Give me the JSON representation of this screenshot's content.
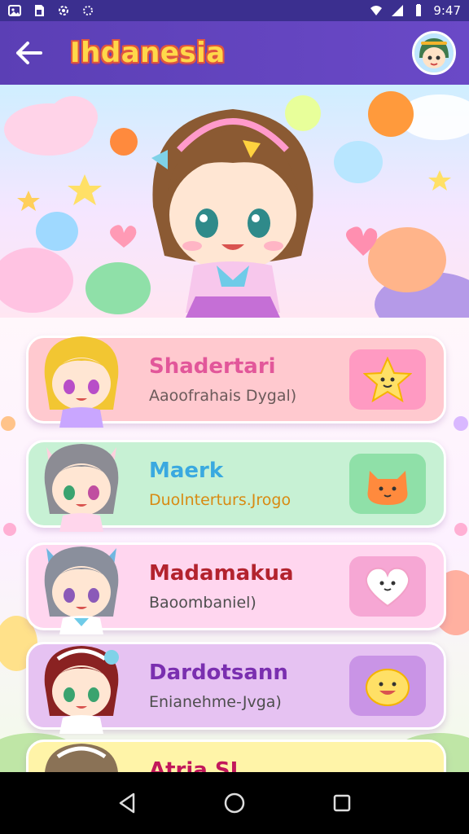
{
  "status_bar": {
    "time": "9:47",
    "left_icons": [
      "photo-icon",
      "sim-icon",
      "settings-icon",
      "settings-alt-icon"
    ],
    "right_icons": [
      "wifi-icon",
      "signal-icon",
      "battery-icon"
    ]
  },
  "app_bar": {
    "title": "Ihdanesia",
    "back_icon": "back-arrow-icon",
    "avatar_icon": "profile-avatar-icon"
  },
  "cards": [
    {
      "title": "Shadertari",
      "subtitle": "Aaoofrahais Dygal)",
      "title_color": "#e2579a",
      "subtitle_color": "#6b5a5a",
      "bg": "#ffc9cf",
      "badge_bg": "#ff9ac2",
      "badge_icon": "star-face-icon",
      "hair_color": "#f2c632"
    },
    {
      "title": "Maerk",
      "subtitle": "Duolnterturs.Jrogo",
      "title_color": "#3aa9e0",
      "subtitle_color": "#d88a12",
      "bg": "#c7f1d4",
      "badge_bg": "#8fe0a8",
      "badge_icon": "orange-cat-icon",
      "hair_color": "#8c8c94"
    },
    {
      "title": "Madamakua",
      "subtitle": "Baoombaniel)",
      "title_color": "#b3232e",
      "subtitle_color": "#4e4e4e",
      "bg": "#ffd6ef",
      "badge_bg": "#f6a7d4",
      "badge_icon": "heart-face-icon",
      "hair_color": "#8a8f9c"
    },
    {
      "title": "Dardotsann",
      "subtitle": "Enianehme-Jvga)",
      "title_color": "#7a2fb0",
      "subtitle_color": "#4e4e4e",
      "bg": "#e6c2f2",
      "badge_bg": "#c994e6",
      "badge_icon": "smile-face-icon",
      "hair_color": "#8a2222"
    },
    {
      "title": "Atria SI",
      "subtitle": "",
      "title_color": "#c2185b",
      "subtitle_color": "#4e4e4e",
      "bg": "#fff4a8",
      "badge_bg": "#ffe36b",
      "badge_icon": "",
      "hair_color": "#8a7256"
    }
  ],
  "nav_bar": {
    "back_icon": "nav-back-icon",
    "home_icon": "nav-home-icon",
    "recents_icon": "nav-recents-icon"
  }
}
